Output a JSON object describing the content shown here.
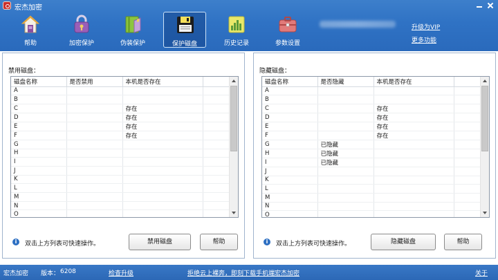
{
  "window": {
    "title": "宏杰加密",
    "controls": {
      "minimize_icon": "minimize-icon",
      "close_icon": "close-icon"
    }
  },
  "toolbar": {
    "items": [
      {
        "label": "帮助",
        "icon": "house-icon",
        "active": false
      },
      {
        "label": "加密保护",
        "icon": "lock-icon",
        "active": false
      },
      {
        "label": "伪装保护",
        "icon": "folder-book-icon",
        "active": false
      },
      {
        "label": "保护磁盘",
        "icon": "floppy-disk-icon",
        "active": true
      },
      {
        "label": "历史记录",
        "icon": "bar-chart-icon",
        "active": false
      },
      {
        "label": "参数设置",
        "icon": "toolbox-icon",
        "active": false
      }
    ],
    "upgrade_link": "升级为VIP",
    "more_link": "更多功能"
  },
  "left_panel": {
    "title": "禁用磁盘：",
    "columns": [
      "磁盘名称",
      "是否禁用",
      "本机是否存在"
    ],
    "rows": [
      [
        "A",
        "",
        ""
      ],
      [
        "B",
        "",
        ""
      ],
      [
        "C",
        "",
        "存在"
      ],
      [
        "D",
        "",
        "存在"
      ],
      [
        "E",
        "",
        "存在"
      ],
      [
        "F",
        "",
        "存在"
      ],
      [
        "G",
        "",
        ""
      ],
      [
        "H",
        "",
        ""
      ],
      [
        "I",
        "",
        ""
      ],
      [
        "J",
        "",
        ""
      ],
      [
        "K",
        "",
        ""
      ],
      [
        "L",
        "",
        ""
      ],
      [
        "M",
        "",
        ""
      ],
      [
        "N",
        "",
        ""
      ],
      [
        "O",
        "",
        ""
      ]
    ],
    "hint": "双击上方列表可快速操作。",
    "action_button": "禁用磁盘",
    "help_button": "帮助"
  },
  "right_panel": {
    "title": "隐藏磁盘：",
    "columns": [
      "磁盘名称",
      "是否隐藏",
      "本机是否存在"
    ],
    "rows": [
      [
        "A",
        "",
        ""
      ],
      [
        "B",
        "",
        ""
      ],
      [
        "C",
        "",
        "存在"
      ],
      [
        "D",
        "",
        "存在"
      ],
      [
        "E",
        "",
        "存在"
      ],
      [
        "F",
        "",
        "存在"
      ],
      [
        "G",
        "已隐藏",
        ""
      ],
      [
        "H",
        "已隐藏",
        ""
      ],
      [
        "I",
        "已隐藏",
        ""
      ],
      [
        "J",
        "",
        ""
      ],
      [
        "K",
        "",
        ""
      ],
      [
        "L",
        "",
        ""
      ],
      [
        "M",
        "",
        ""
      ],
      [
        "N",
        "",
        ""
      ],
      [
        "O",
        "",
        ""
      ]
    ],
    "hint": "双击上方列表可快速操作。",
    "action_button": "隐藏磁盘",
    "help_button": "帮助"
  },
  "statusbar": {
    "app_name": "宏杰加密",
    "version_label": "版本：",
    "version": "6208",
    "check_upgrade": "检查升级",
    "promo": "拒绝云上裸奔，即刻下载手机端宏杰加密",
    "about": "关于"
  },
  "colors": {
    "titlebar": "#2f72c4",
    "statusbar": "#2c68b6",
    "panel_border": "#9fb4cd",
    "info_icon": "#2d6fc2"
  }
}
